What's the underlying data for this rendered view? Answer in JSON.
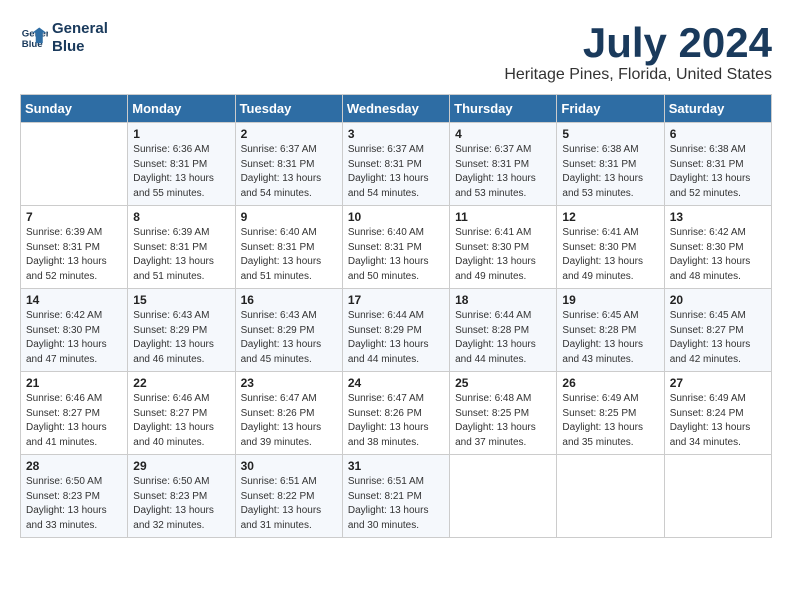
{
  "header": {
    "logo_line1": "General",
    "logo_line2": "Blue",
    "month_title": "July 2024",
    "location": "Heritage Pines, Florida, United States"
  },
  "days_of_week": [
    "Sunday",
    "Monday",
    "Tuesday",
    "Wednesday",
    "Thursday",
    "Friday",
    "Saturday"
  ],
  "weeks": [
    [
      {
        "day": "",
        "sunrise": "",
        "sunset": "",
        "daylight": ""
      },
      {
        "day": "1",
        "sunrise": "Sunrise: 6:36 AM",
        "sunset": "Sunset: 8:31 PM",
        "daylight": "Daylight: 13 hours and 55 minutes."
      },
      {
        "day": "2",
        "sunrise": "Sunrise: 6:37 AM",
        "sunset": "Sunset: 8:31 PM",
        "daylight": "Daylight: 13 hours and 54 minutes."
      },
      {
        "day": "3",
        "sunrise": "Sunrise: 6:37 AM",
        "sunset": "Sunset: 8:31 PM",
        "daylight": "Daylight: 13 hours and 54 minutes."
      },
      {
        "day": "4",
        "sunrise": "Sunrise: 6:37 AM",
        "sunset": "Sunset: 8:31 PM",
        "daylight": "Daylight: 13 hours and 53 minutes."
      },
      {
        "day": "5",
        "sunrise": "Sunrise: 6:38 AM",
        "sunset": "Sunset: 8:31 PM",
        "daylight": "Daylight: 13 hours and 53 minutes."
      },
      {
        "day": "6",
        "sunrise": "Sunrise: 6:38 AM",
        "sunset": "Sunset: 8:31 PM",
        "daylight": "Daylight: 13 hours and 52 minutes."
      }
    ],
    [
      {
        "day": "7",
        "sunrise": "Sunrise: 6:39 AM",
        "sunset": "Sunset: 8:31 PM",
        "daylight": "Daylight: 13 hours and 52 minutes."
      },
      {
        "day": "8",
        "sunrise": "Sunrise: 6:39 AM",
        "sunset": "Sunset: 8:31 PM",
        "daylight": "Daylight: 13 hours and 51 minutes."
      },
      {
        "day": "9",
        "sunrise": "Sunrise: 6:40 AM",
        "sunset": "Sunset: 8:31 PM",
        "daylight": "Daylight: 13 hours and 51 minutes."
      },
      {
        "day": "10",
        "sunrise": "Sunrise: 6:40 AM",
        "sunset": "Sunset: 8:31 PM",
        "daylight": "Daylight: 13 hours and 50 minutes."
      },
      {
        "day": "11",
        "sunrise": "Sunrise: 6:41 AM",
        "sunset": "Sunset: 8:30 PM",
        "daylight": "Daylight: 13 hours and 49 minutes."
      },
      {
        "day": "12",
        "sunrise": "Sunrise: 6:41 AM",
        "sunset": "Sunset: 8:30 PM",
        "daylight": "Daylight: 13 hours and 49 minutes."
      },
      {
        "day": "13",
        "sunrise": "Sunrise: 6:42 AM",
        "sunset": "Sunset: 8:30 PM",
        "daylight": "Daylight: 13 hours and 48 minutes."
      }
    ],
    [
      {
        "day": "14",
        "sunrise": "Sunrise: 6:42 AM",
        "sunset": "Sunset: 8:30 PM",
        "daylight": "Daylight: 13 hours and 47 minutes."
      },
      {
        "day": "15",
        "sunrise": "Sunrise: 6:43 AM",
        "sunset": "Sunset: 8:29 PM",
        "daylight": "Daylight: 13 hours and 46 minutes."
      },
      {
        "day": "16",
        "sunrise": "Sunrise: 6:43 AM",
        "sunset": "Sunset: 8:29 PM",
        "daylight": "Daylight: 13 hours and 45 minutes."
      },
      {
        "day": "17",
        "sunrise": "Sunrise: 6:44 AM",
        "sunset": "Sunset: 8:29 PM",
        "daylight": "Daylight: 13 hours and 44 minutes."
      },
      {
        "day": "18",
        "sunrise": "Sunrise: 6:44 AM",
        "sunset": "Sunset: 8:28 PM",
        "daylight": "Daylight: 13 hours and 44 minutes."
      },
      {
        "day": "19",
        "sunrise": "Sunrise: 6:45 AM",
        "sunset": "Sunset: 8:28 PM",
        "daylight": "Daylight: 13 hours and 43 minutes."
      },
      {
        "day": "20",
        "sunrise": "Sunrise: 6:45 AM",
        "sunset": "Sunset: 8:27 PM",
        "daylight": "Daylight: 13 hours and 42 minutes."
      }
    ],
    [
      {
        "day": "21",
        "sunrise": "Sunrise: 6:46 AM",
        "sunset": "Sunset: 8:27 PM",
        "daylight": "Daylight: 13 hours and 41 minutes."
      },
      {
        "day": "22",
        "sunrise": "Sunrise: 6:46 AM",
        "sunset": "Sunset: 8:27 PM",
        "daylight": "Daylight: 13 hours and 40 minutes."
      },
      {
        "day": "23",
        "sunrise": "Sunrise: 6:47 AM",
        "sunset": "Sunset: 8:26 PM",
        "daylight": "Daylight: 13 hours and 39 minutes."
      },
      {
        "day": "24",
        "sunrise": "Sunrise: 6:47 AM",
        "sunset": "Sunset: 8:26 PM",
        "daylight": "Daylight: 13 hours and 38 minutes."
      },
      {
        "day": "25",
        "sunrise": "Sunrise: 6:48 AM",
        "sunset": "Sunset: 8:25 PM",
        "daylight": "Daylight: 13 hours and 37 minutes."
      },
      {
        "day": "26",
        "sunrise": "Sunrise: 6:49 AM",
        "sunset": "Sunset: 8:25 PM",
        "daylight": "Daylight: 13 hours and 35 minutes."
      },
      {
        "day": "27",
        "sunrise": "Sunrise: 6:49 AM",
        "sunset": "Sunset: 8:24 PM",
        "daylight": "Daylight: 13 hours and 34 minutes."
      }
    ],
    [
      {
        "day": "28",
        "sunrise": "Sunrise: 6:50 AM",
        "sunset": "Sunset: 8:23 PM",
        "daylight": "Daylight: 13 hours and 33 minutes."
      },
      {
        "day": "29",
        "sunrise": "Sunrise: 6:50 AM",
        "sunset": "Sunset: 8:23 PM",
        "daylight": "Daylight: 13 hours and 32 minutes."
      },
      {
        "day": "30",
        "sunrise": "Sunrise: 6:51 AM",
        "sunset": "Sunset: 8:22 PM",
        "daylight": "Daylight: 13 hours and 31 minutes."
      },
      {
        "day": "31",
        "sunrise": "Sunrise: 6:51 AM",
        "sunset": "Sunset: 8:21 PM",
        "daylight": "Daylight: 13 hours and 30 minutes."
      },
      {
        "day": "",
        "sunrise": "",
        "sunset": "",
        "daylight": ""
      },
      {
        "day": "",
        "sunrise": "",
        "sunset": "",
        "daylight": ""
      },
      {
        "day": "",
        "sunrise": "",
        "sunset": "",
        "daylight": ""
      }
    ]
  ]
}
